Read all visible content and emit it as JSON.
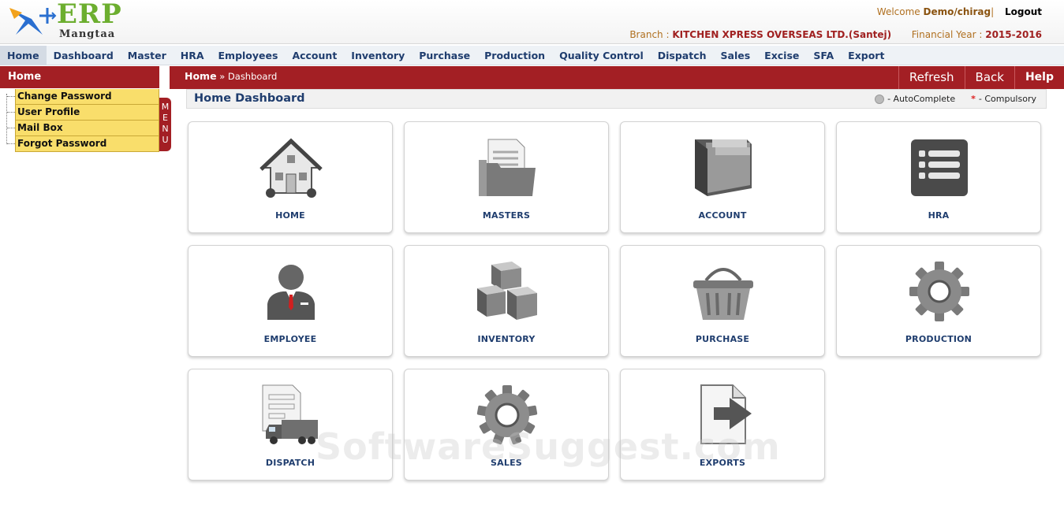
{
  "header": {
    "logo_text": "ERP",
    "logo_subtext": "Mangtaa",
    "welcome_label": "Welcome",
    "user": "Demo/chirag",
    "separator": "|",
    "logout_label": "Logout",
    "branch_label": "Branch :",
    "branch_value": "KITCHEN XPRESS OVERSEAS LTD.(Santej)",
    "fy_label": "Financial Year :",
    "fy_value": "2015-2016"
  },
  "nav": {
    "items": [
      "Home",
      "Dashboard",
      "Master",
      "HRA",
      "Employees",
      "Account",
      "Inventory",
      "Purchase",
      "Production",
      "Quality Control",
      "Dispatch",
      "Sales",
      "Excise",
      "SFA",
      "Export"
    ],
    "active": "Home"
  },
  "left_panel": {
    "title": "Home",
    "items": [
      "Change Password",
      "User Profile",
      "Mail Box",
      "Forgot Password"
    ],
    "menu_tab": [
      "M",
      "E",
      "N",
      "U"
    ]
  },
  "breadcrumb": {
    "root": "Home",
    "current": "» Dashboard"
  },
  "toolbar": {
    "refresh_label": "Refresh",
    "back_label": "Back",
    "help_label": "Help"
  },
  "page": {
    "title": "Home Dashboard",
    "legend_autocomplete": "- AutoComplete",
    "legend_star": "*",
    "legend_compulsory": "- Compulsory"
  },
  "tiles": [
    {
      "label": "HOME",
      "icon": "house-icon"
    },
    {
      "label": "MASTERS",
      "icon": "folder-document-icon"
    },
    {
      "label": "ACCOUNT",
      "icon": "wallet-icon"
    },
    {
      "label": "HRA",
      "icon": "list-icon"
    },
    {
      "label": "EMPLOYEE",
      "icon": "person-icon"
    },
    {
      "label": "INVENTORY",
      "icon": "boxes-icon"
    },
    {
      "label": "PURCHASE",
      "icon": "basket-icon"
    },
    {
      "label": "PRODUCTION",
      "icon": "gear-icon"
    },
    {
      "label": "DISPATCH",
      "icon": "truck-document-icon"
    },
    {
      "label": "SALES",
      "icon": "gear-icon"
    },
    {
      "label": "EXPORTS",
      "icon": "export-arrow-icon"
    }
  ],
  "watermark": "SoftwareSuggest.com",
  "colors": {
    "brand_red": "#a31f24",
    "nav_text": "#1f3d6e",
    "menu_yellow": "#f9de6b",
    "logo_green": "#6cae2f"
  }
}
